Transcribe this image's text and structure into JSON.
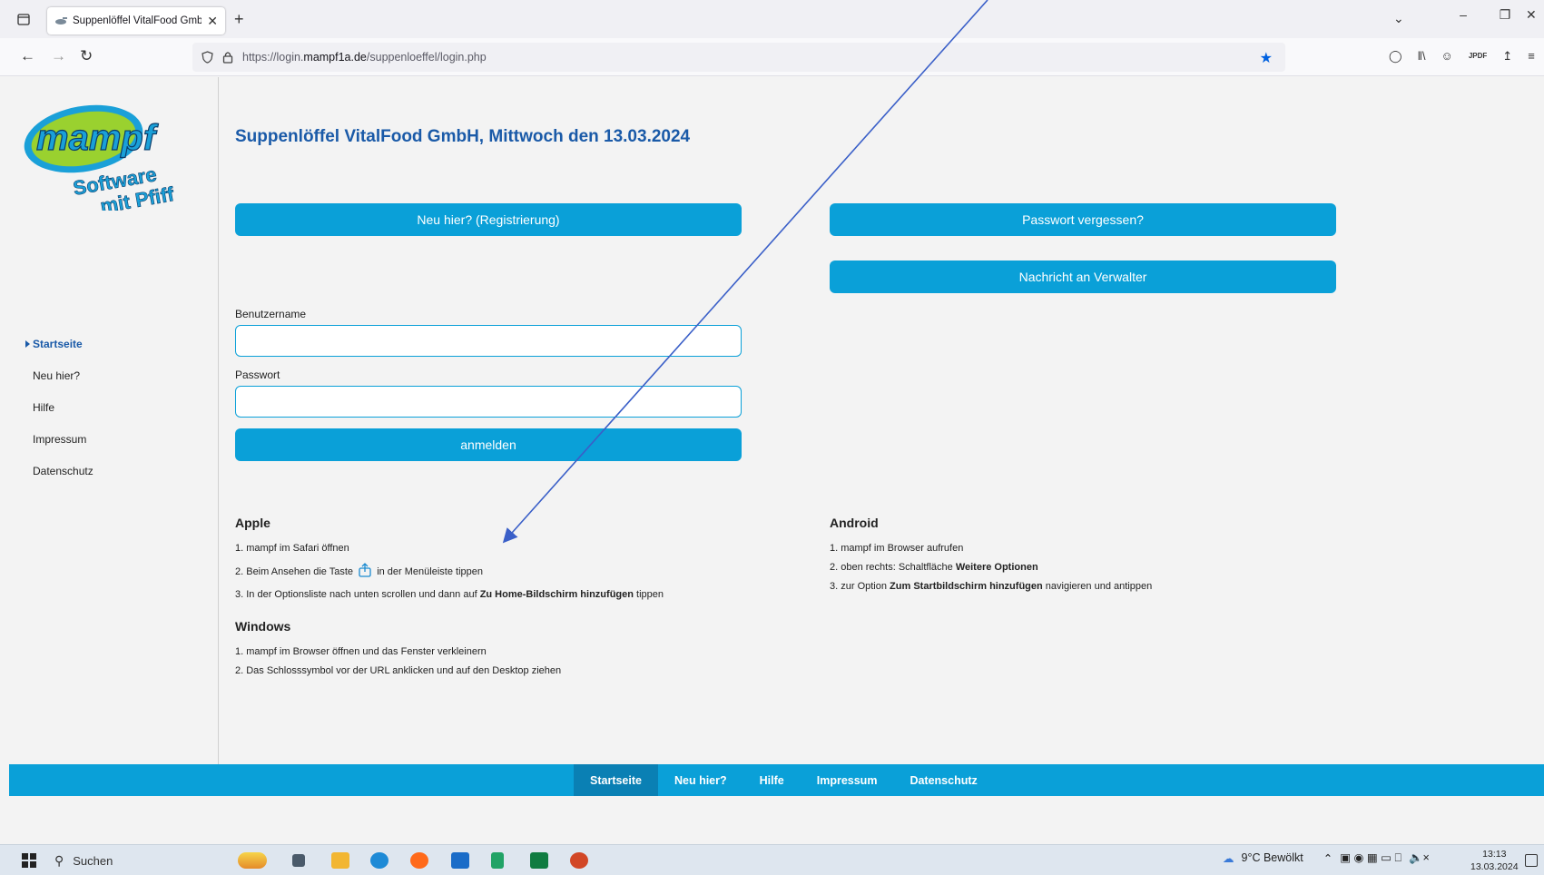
{
  "browser": {
    "tab_title": "Suppenlöffel VitalFood GmbH",
    "tab_close": "✕",
    "new_tab": "+",
    "url_prefix": "https://login.",
    "url_domain": "mampf1a.de",
    "url_path": "/suppenloeffel/login.php"
  },
  "sidebar": {
    "logo_top": "mampf",
    "logo_line1": "Software",
    "logo_line2": "mit Pfiff",
    "items": [
      {
        "label": "Startseite",
        "active": true
      },
      {
        "label": "Neu hier?"
      },
      {
        "label": "Hilfe"
      },
      {
        "label": "Impressum"
      },
      {
        "label": "Datenschutz"
      }
    ]
  },
  "main": {
    "title": "Suppenlöffel VitalFood GmbH, Mittwoch den 13.03.2024",
    "register_button": "Neu hier? (Registrierung)",
    "forgot_button": "Passwort vergessen?",
    "message_button": "Nachricht an Verwalter",
    "username_label": "Benutzername",
    "password_label": "Passwort",
    "login_button": "anmelden"
  },
  "instructions": {
    "apple": {
      "heading": "Apple",
      "step1": "1. mampf im Safari öffnen",
      "step2_pre": "2. Beim Ansehen die Taste",
      "step2_post": "in der Menüleiste tippen",
      "step3_pre": "3. In der Optionsliste nach unten scrollen und dann auf",
      "step3_bold": "Zu Home-Bildschirm hinzufügen",
      "step3_post": "tippen"
    },
    "windows": {
      "heading": "Windows",
      "step1": "1. mampf im Browser öffnen und das Fenster verkleinern",
      "step2": "2. Das Schlosssymbol vor der URL anklicken und auf den Desktop ziehen"
    },
    "android": {
      "heading": "Android",
      "step1": "1. mampf im Browser aufrufen",
      "step2_pre": "2. oben rechts: Schaltfläche",
      "step2_bold": "Weitere Optionen",
      "step3_pre": "3. zur Option",
      "step3_bold": "Zum Startbildschirm hinzufügen",
      "step3_post": "navigieren und antippen"
    }
  },
  "footer": {
    "items": [
      {
        "label": "Startseite",
        "active": true
      },
      {
        "label": "Neu hier?"
      },
      {
        "label": "Hilfe"
      },
      {
        "label": "Impressum"
      },
      {
        "label": "Datenschutz"
      }
    ]
  },
  "taskbar": {
    "search_label": "Suchen",
    "weather": "9°C  Bewölkt",
    "time": "13:13",
    "date": "13.03.2024"
  },
  "colors": {
    "accent": "#0aa0d8",
    "title_blue": "#1a5aa8",
    "arrow": "#3a5fc8"
  }
}
